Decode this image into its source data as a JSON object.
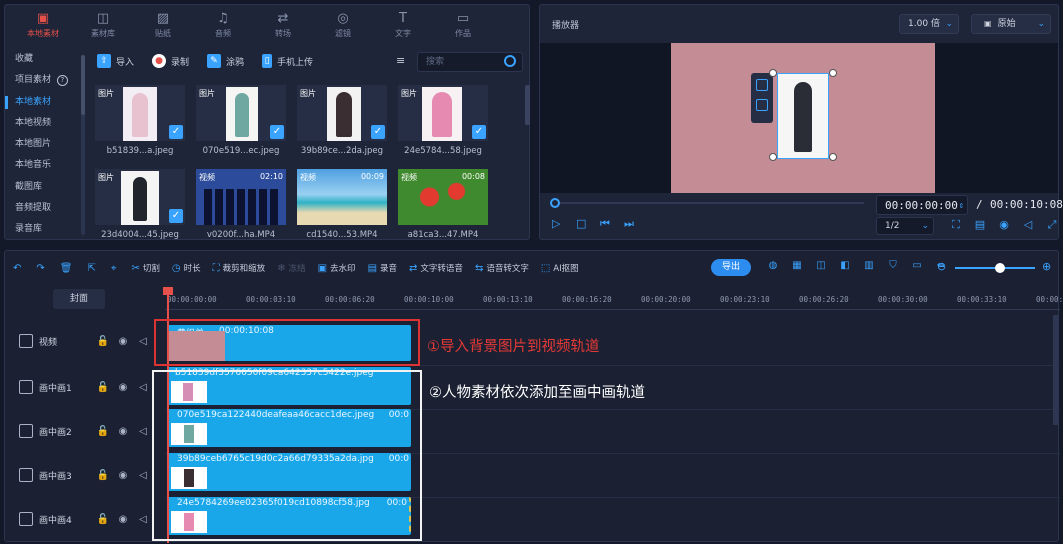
{
  "media_panel": {
    "nav": [
      {
        "label": "本地素材",
        "icon": "folder-icon",
        "active": true
      },
      {
        "label": "素材库",
        "icon": "library-icon"
      },
      {
        "label": "贴纸",
        "icon": "sticker-icon"
      },
      {
        "label": "音频",
        "icon": "music-icon"
      },
      {
        "label": "转场",
        "icon": "transition-icon"
      },
      {
        "label": "滤镜",
        "icon": "filter-icon"
      },
      {
        "label": "文字",
        "icon": "text-icon"
      },
      {
        "label": "作品",
        "icon": "works-icon"
      }
    ],
    "sidebar": [
      "收藏",
      "项目素材",
      "本地素材",
      "本地视频",
      "本地图片",
      "本地音乐",
      "截图库",
      "音频提取",
      "录音库"
    ],
    "sidebar_help": "?",
    "tools": [
      {
        "label": "导入",
        "icon": "import-icon",
        "color": "#3aa3ff"
      },
      {
        "label": "录制",
        "icon": "record-icon",
        "color": "#e5504a"
      },
      {
        "label": "涂鸦",
        "icon": "brush-icon",
        "color": "#3aa3ff"
      },
      {
        "label": "手机上传",
        "icon": "phone-icon",
        "color": "#3aa3ff"
      }
    ],
    "sort_icon": "≡",
    "search_placeholder": "搜索",
    "items": [
      {
        "type": "图片",
        "name": "b51839...a.jpeg",
        "checked": true
      },
      {
        "type": "图片",
        "name": "070e519...ec.jpeg",
        "checked": true
      },
      {
        "type": "图片",
        "name": "39b89ce...2da.jpeg",
        "checked": true
      },
      {
        "type": "图片",
        "name": "24e5784...58.jpeg",
        "checked": true
      },
      {
        "type": "图片",
        "name": "23d4004...45.jpeg",
        "checked": true
      },
      {
        "type": "视频",
        "name": "v0200f...ha.MP4",
        "duration": "02:10"
      },
      {
        "type": "视频",
        "name": "cd1540...53.MP4",
        "duration": "00:09"
      },
      {
        "type": "视频",
        "name": "a81ca3...47.MP4",
        "duration": "00:08"
      }
    ]
  },
  "player": {
    "title": "播放器",
    "speed": "1.00 倍",
    "aspect": "原始",
    "current_time": "00:00:00:00",
    "separator": "/",
    "total_time": "00:00:10:08",
    "ratio": "1/2"
  },
  "timeline": {
    "tools": [
      {
        "label": "",
        "icon": "↶"
      },
      {
        "label": "",
        "icon": "↷"
      },
      {
        "label": "",
        "icon": "🗑"
      },
      {
        "label": "",
        "icon": "⇱"
      },
      {
        "label": "",
        "icon": "⌖"
      },
      {
        "label": "切割",
        "icon": "✂"
      },
      {
        "label": "时长",
        "icon": "◷"
      },
      {
        "label": "裁剪和缩放",
        "icon": "⛶"
      },
      {
        "label": "冻结",
        "icon": "❄",
        "disabled": true
      },
      {
        "label": "去水印",
        "icon": "▣"
      },
      {
        "label": "录音",
        "icon": "▤"
      },
      {
        "label": "文字转语音",
        "icon": "⇄"
      },
      {
        "label": "语音转文字",
        "icon": "⇆"
      },
      {
        "label": "AI抠图",
        "icon": "⬚"
      }
    ],
    "export_label": "导出",
    "cover_label": "封面",
    "ruler": [
      "00:00:00:00",
      "00:00:03:10",
      "00:00:06:20",
      "00:00:10:00",
      "00:00:13:10",
      "00:00:16:20",
      "00:00:20:00",
      "00:00:23:10",
      "00:00:26:20",
      "00:00:30:00",
      "00:00:33:10",
      "00:00:3"
    ],
    "tracks": [
      {
        "name": "视频",
        "clip": "黄织单",
        "clip_time": "00:00:10:08"
      },
      {
        "name": "画中画1",
        "clip": "b51839df3576650f09ca642337c5422e.jpeg",
        "clip_time": ""
      },
      {
        "name": "画中画2",
        "clip": "070e519ca122440deafeaa46cacc1dec.jpeg",
        "clip_time": "00:0"
      },
      {
        "name": "画中画3",
        "clip": "39b89ceb6765c19d0c2a66d79335a2da.jpg",
        "clip_time": "00:0"
      },
      {
        "name": "画中画4",
        "clip": "24e5784269ee02365f019cd10898cf58.jpg",
        "clip_time": "00:0"
      }
    ],
    "annotation_1": "①导入背景图片到视频轨道",
    "annotation_2": "②人物素材依次添加至画中画轨道",
    "annotation_1_color": "#e53935",
    "annotation_2_color": "#ffffff"
  }
}
